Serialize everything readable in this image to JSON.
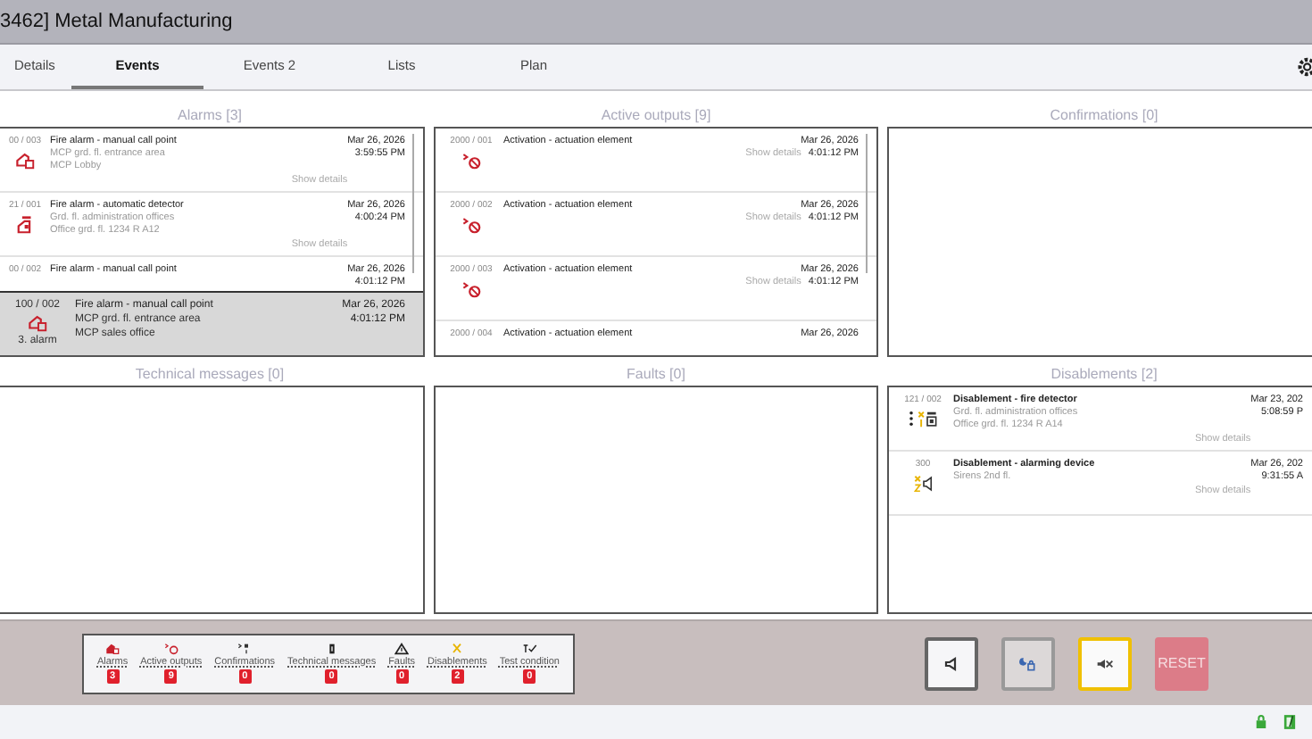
{
  "window": {
    "title": "3462] Metal Manufacturing"
  },
  "tabs": [
    {
      "label": "Details",
      "selected": false
    },
    {
      "label": "Events",
      "selected": true
    },
    {
      "label": "Events 2",
      "selected": false
    },
    {
      "label": "Lists",
      "selected": false
    },
    {
      "label": "Plan",
      "selected": false
    }
  ],
  "panels": [
    {
      "title": "Alarms [3]",
      "kind": "alarms",
      "scrollbar": true,
      "items": [
        {
          "kind": "manual_call_point",
          "address": "00 / 003",
          "title": "Fire alarm - manual call point",
          "lines": [
            "MCP grd. fl. entrance area",
            "MCP Lobby"
          ],
          "date": "Mar 26, 2026",
          "time": "3:59:55 PM",
          "details": "Show details"
        },
        {
          "kind": "detector",
          "address": "21 / 001",
          "title": "Fire alarm - automatic detector",
          "lines": [
            "Grd. fl. administration offices",
            "Office grd. fl. 1234 R A12"
          ],
          "date": "Mar 26, 2026",
          "time": "4:00:24 PM",
          "details": "Show details"
        },
        {
          "address": "00 / 002",
          "title": "Fire alarm - manual call point",
          "date": "Mar 26, 2026",
          "time": "4:01:12 PM"
        }
      ],
      "current": {
        "kind": "manual_call_point",
        "address": "100 / 002",
        "title": "Fire alarm - manual call point",
        "lines": [
          "MCP grd. fl. entrance area",
          "MCP sales office"
        ],
        "date": "Mar 26, 2026",
        "time": "4:01:12 PM",
        "label": "3. alarm"
      }
    },
    {
      "title": "Active outputs [9]",
      "kind": "outputs",
      "scrollbar": true,
      "items": [
        {
          "kind": "actuation",
          "address": "2000 / 001",
          "title": "Activation - actuation element",
          "date": "Mar 26, 2026",
          "time": "4:01:12 PM",
          "details": "Show details"
        },
        {
          "kind": "actuation",
          "address": "2000 / 002",
          "title": "Activation - actuation element",
          "date": "Mar 26, 2026",
          "time": "4:01:12 PM",
          "details": "Show details"
        },
        {
          "kind": "actuation",
          "address": "2000 / 003",
          "title": "Activation - actuation element",
          "date": "Mar 26, 2026",
          "time": "4:01:12 PM",
          "details": "Show details"
        },
        {
          "address": "2000 / 004",
          "title": "Activation - actuation element",
          "date": "Mar 26, 2026"
        }
      ]
    },
    {
      "title": "Confirmations [0]",
      "kind": "plain"
    },
    {
      "title": "Technical messages [0]",
      "kind": "plain"
    },
    {
      "title": "Faults [0]",
      "kind": "plain"
    },
    {
      "title": "Disablements [2]",
      "kind": "disablements",
      "items": [
        {
          "kind": "disabled_detector",
          "has_menu": true,
          "address": "121 / 002",
          "title": "Disablement - fire detector",
          "lines": [
            "Grd. fl. administration offices",
            "Office grd. fl. 1234 R A14"
          ],
          "date": "Mar 23, 202",
          "time": "5:08:59 P",
          "details": "Show details"
        },
        {
          "kind": "disabled_device",
          "has_menu": false,
          "address": "300",
          "title": "Disablement - alarming device",
          "lines": [
            "Sirens 2nd fl."
          ],
          "date": "Mar 26, 202",
          "time": "9:31:55 A",
          "details": "Show details"
        }
      ]
    }
  ],
  "summary": [
    {
      "kind": "alarm",
      "label": "Alarms",
      "count": "3"
    },
    {
      "kind": "output",
      "label": "Active outputs",
      "count": "9"
    },
    {
      "kind": "confirmation",
      "label": "Confirmations",
      "count": "0"
    },
    {
      "kind": "technical",
      "label": "Technical messages",
      "count": "0"
    },
    {
      "kind": "fault",
      "label": "Faults",
      "count": "0"
    },
    {
      "kind": "disablement",
      "label": "Disablements",
      "count": "2"
    },
    {
      "kind": "test",
      "label": "Test condition",
      "count": "0"
    }
  ],
  "buttons": [
    {
      "kind": "buzzer",
      "highlighted": false,
      "disabled": false
    },
    {
      "kind": "night",
      "highlighted": false,
      "disabled": true
    },
    {
      "kind": "mute",
      "highlighted": true,
      "disabled": false
    },
    {
      "kind": "reset",
      "label": "RESET",
      "highlighted": false,
      "disabled": true
    }
  ]
}
